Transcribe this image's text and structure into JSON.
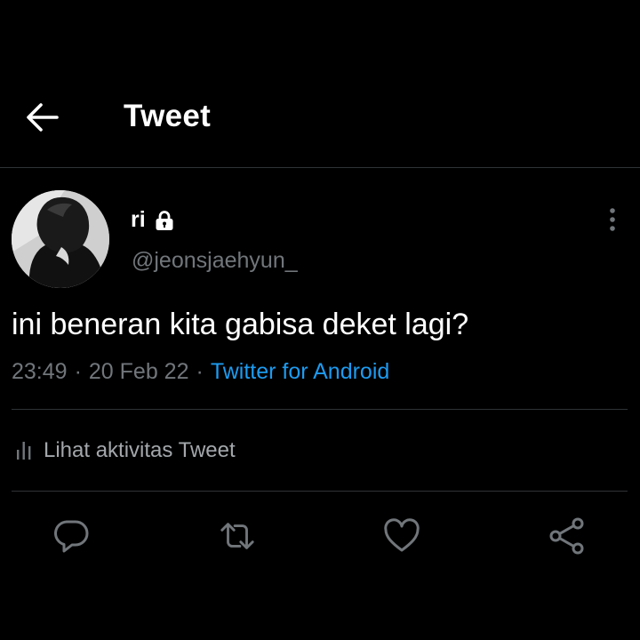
{
  "header": {
    "title": "Tweet",
    "back_icon": "arrow-left-icon"
  },
  "author": {
    "display_name": "ri",
    "badge_icon": "lock-icon",
    "handle": "@jeonsjaehyun_"
  },
  "tweet": {
    "text": "ini beneran kita gabisa deket lagi?",
    "time": "23:49",
    "date": "20 Feb 22",
    "separator": "·",
    "client": "Twitter for Android"
  },
  "activity": {
    "label": "Lihat aktivitas Tweet",
    "icon": "analytics-icon"
  },
  "actions": [
    "reply-icon",
    "retweet-icon",
    "like-icon",
    "share-icon"
  ],
  "colors": {
    "background": "#000000",
    "text": "#ffffff",
    "secondary_text": "#71767b",
    "link": "#1d9bf0",
    "divider": "#2f3336"
  }
}
